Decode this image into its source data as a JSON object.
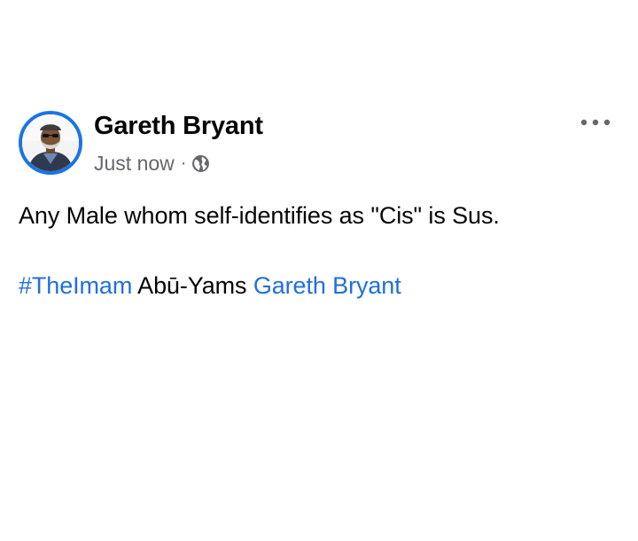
{
  "post": {
    "author_name": "Gareth Bryant",
    "timestamp": "Just now",
    "separator": "·",
    "privacy_icon": "globe-icon",
    "more_icon": "more-options-icon",
    "text": "Any Male whom self-identifies as \"Cis\" is Sus.",
    "hashtag": "#TheImam",
    "plain_word": "Abū-Yams",
    "mention": "Gareth Bryant"
  },
  "colors": {
    "link": "#216fdb",
    "avatar_ring": "#1b74e4",
    "secondary_text": "#65676b",
    "primary_text": "#050505"
  }
}
